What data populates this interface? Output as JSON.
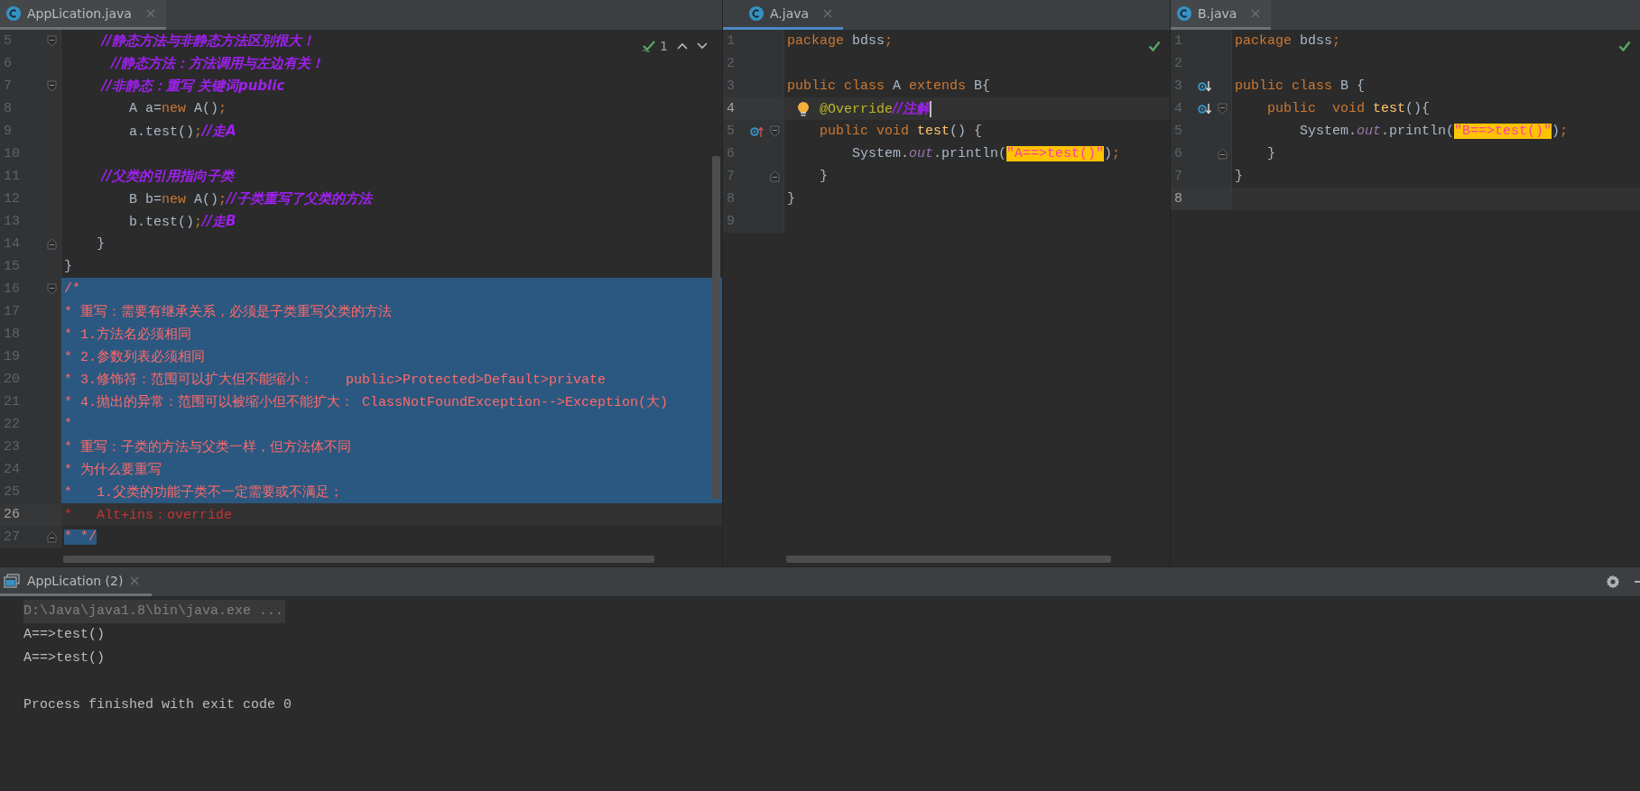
{
  "editors": [
    {
      "tab": {
        "label": "AppLication.java",
        "active": false
      },
      "status": {
        "kind": "inspections",
        "count": "1"
      },
      "lines": [
        {
          "number": "5",
          "fold_start": true,
          "tokens": [
            {
              "kind": "comment",
              "text": "        //静态方法与非静态方法区别很大！"
            }
          ]
        },
        {
          "number": "6",
          "tokens": [
            {
              "kind": "comment",
              "text": "          //静态方法：方法调用与左边有关！"
            }
          ]
        },
        {
          "number": "7",
          "fold_start": true,
          "tokens": [
            {
              "kind": "comment",
              "text": "        //非静态：重写 关键词public"
            }
          ]
        },
        {
          "number": "8",
          "tokens": [
            {
              "kind": "plain",
              "text": "        A a="
            },
            {
              "kind": "keyword",
              "text": "new"
            },
            {
              "kind": "plain",
              "text": " A()"
            },
            {
              "kind": "keyword",
              "text": ";"
            }
          ]
        },
        {
          "number": "9",
          "tokens": [
            {
              "kind": "plain",
              "text": "        a.test()"
            },
            {
              "kind": "keyword",
              "text": ";"
            },
            {
              "kind": "comment",
              "text": "//走A"
            }
          ]
        },
        {
          "number": "10"
        },
        {
          "number": "11",
          "tokens": [
            {
              "kind": "comment",
              "text": "        //父类的引用指向子类"
            }
          ]
        },
        {
          "number": "12",
          "tokens": [
            {
              "kind": "plain",
              "text": "        B b="
            },
            {
              "kind": "keyword",
              "text": "new"
            },
            {
              "kind": "plain",
              "text": " A()"
            },
            {
              "kind": "keyword",
              "text": ";"
            },
            {
              "kind": "comment",
              "text": "//子类重写了父类的方法"
            }
          ]
        },
        {
          "number": "13",
          "tokens": [
            {
              "kind": "plain",
              "text": "        b.test()"
            },
            {
              "kind": "keyword",
              "text": ";"
            },
            {
              "kind": "comment",
              "text": "//走B"
            }
          ]
        },
        {
          "number": "14",
          "fold_end": true,
          "tokens": [
            {
              "kind": "plain",
              "text": "    }"
            }
          ]
        },
        {
          "number": "15",
          "tokens": [
            {
              "kind": "plain",
              "text": "}"
            }
          ]
        },
        {
          "number": "16",
          "fold_start": true,
          "selected": true,
          "tokens": [
            {
              "kind": "doc",
              "text": "/*"
            }
          ]
        },
        {
          "number": "17",
          "selected": true,
          "tokens": [
            {
              "kind": "doc",
              "text": "* 重写：需要有继承关系，必须是子类重写父类的方法"
            }
          ]
        },
        {
          "number": "18",
          "selected": true,
          "tokens": [
            {
              "kind": "doc",
              "text": "* 1.方法名必须相同"
            }
          ]
        },
        {
          "number": "19",
          "selected": true,
          "tokens": [
            {
              "kind": "doc",
              "text": "* 2.参数列表必须相同"
            }
          ]
        },
        {
          "number": "20",
          "selected": true,
          "tokens": [
            {
              "kind": "doc",
              "text": "* 3.修饰符：范围可以扩大但不能缩小：    public>Protected>Default>private"
            }
          ]
        },
        {
          "number": "21",
          "selected": true,
          "tokens": [
            {
              "kind": "doc",
              "text": "* 4.抛出的异常：范围可以被缩小但不能扩大： ClassNotFoundException-->Exception(大)"
            }
          ]
        },
        {
          "number": "22",
          "selected": true,
          "tokens": [
            {
              "kind": "doc",
              "text": "*"
            }
          ]
        },
        {
          "number": "23",
          "selected": true,
          "tokens": [
            {
              "kind": "doc",
              "text": "* 重写：子类的方法与父类一样，但方法体不同"
            }
          ]
        },
        {
          "number": "24",
          "selected": true,
          "tokens": [
            {
              "kind": "doc",
              "text": "* 为什么要重写"
            }
          ]
        },
        {
          "number": "25",
          "selected": true,
          "tokens": [
            {
              "kind": "doc",
              "text": "*   1.父类的功能子类不一定需要或不满足；"
            }
          ]
        },
        {
          "number": "26",
          "current": true,
          "selected": false,
          "tokens": [
            {
              "kind": "doc",
              "text": "*   Alt+ins：override"
            }
          ]
        },
        {
          "number": "27",
          "fold_end": true,
          "selected_text": true,
          "tokens": [
            {
              "kind": "doc",
              "text": "* */"
            }
          ]
        }
      ]
    },
    {
      "tab": {
        "label": "A.java",
        "active": true
      },
      "status": {
        "kind": "ok"
      },
      "lines": [
        {
          "number": "1",
          "tokens": [
            {
              "kind": "keyword",
              "text": "package"
            },
            {
              "kind": "plain",
              "text": " bdss"
            },
            {
              "kind": "keyword",
              "text": ";"
            }
          ]
        },
        {
          "number": "2"
        },
        {
          "number": "3",
          "tokens": [
            {
              "kind": "keyword",
              "text": "public class"
            },
            {
              "kind": "plain",
              "text": " A "
            },
            {
              "kind": "keyword",
              "text": "extends"
            },
            {
              "kind": "plain",
              "text": " B{"
            }
          ]
        },
        {
          "number": "4",
          "current": true,
          "bulb": true,
          "caret": true,
          "tokens": [
            {
              "kind": "annotation",
              "text": "    @Override"
            },
            {
              "kind": "comment",
              "text": "//注解"
            }
          ]
        },
        {
          "number": "5",
          "overrides": true,
          "fold_start": true,
          "tokens": [
            {
              "kind": "keyword",
              "text": "    public void "
            },
            {
              "kind": "method",
              "text": "test"
            },
            {
              "kind": "plain",
              "text": "() {"
            }
          ]
        },
        {
          "number": "6",
          "tokens": [
            {
              "kind": "plain",
              "text": "        System."
            },
            {
              "kind": "field",
              "text": "out"
            },
            {
              "kind": "plain",
              "text": ".println("
            },
            {
              "kind": "match",
              "text": "\"A==>test()\""
            },
            {
              "kind": "plain",
              "text": ")"
            },
            {
              "kind": "keyword",
              "text": ";"
            }
          ]
        },
        {
          "number": "7",
          "fold_end": true,
          "tokens": [
            {
              "kind": "plain",
              "text": "    }"
            }
          ]
        },
        {
          "number": "8",
          "tokens": [
            {
              "kind": "plain",
              "text": "}"
            }
          ]
        },
        {
          "number": "9"
        }
      ]
    },
    {
      "tab": {
        "label": "B.java",
        "active": false
      },
      "status": {
        "kind": "ok"
      },
      "lines": [
        {
          "number": "1",
          "tokens": [
            {
              "kind": "keyword",
              "text": "package"
            },
            {
              "kind": "plain",
              "text": " bdss"
            },
            {
              "kind": "keyword",
              "text": ";"
            }
          ]
        },
        {
          "number": "2"
        },
        {
          "number": "3",
          "implemented": true,
          "tokens": [
            {
              "kind": "keyword",
              "text": "public class"
            },
            {
              "kind": "plain",
              "text": " B {"
            }
          ]
        },
        {
          "number": "4",
          "implemented": true,
          "fold_start": true,
          "tokens": [
            {
              "kind": "keyword",
              "text": "    public  void "
            },
            {
              "kind": "method",
              "text": "test"
            },
            {
              "kind": "plain",
              "text": "(){"
            }
          ]
        },
        {
          "number": "5",
          "tokens": [
            {
              "kind": "plain",
              "text": "        System."
            },
            {
              "kind": "field",
              "text": "out"
            },
            {
              "kind": "plain",
              "text": ".println("
            },
            {
              "kind": "match",
              "text": "\"B==>test()\""
            },
            {
              "kind": "plain",
              "text": ")"
            },
            {
              "kind": "keyword",
              "text": ";"
            }
          ]
        },
        {
          "number": "6",
          "fold_end": true,
          "tokens": [
            {
              "kind": "plain",
              "text": "    }"
            }
          ]
        },
        {
          "number": "7",
          "tokens": [
            {
              "kind": "plain",
              "text": "}"
            }
          ]
        },
        {
          "number": "8",
          "current": true
        }
      ]
    }
  ],
  "run_panel": {
    "tab": {
      "label": "AppLication (2)"
    },
    "lines": [
      {
        "kind": "command",
        "text": "D:\\Java\\java1.8\\bin\\java.exe ..."
      },
      {
        "kind": "output",
        "text": "A==>test()"
      },
      {
        "kind": "output",
        "text": "A==>test()"
      },
      {
        "kind": "exit",
        "text": "Process finished with exit code 0"
      }
    ]
  }
}
